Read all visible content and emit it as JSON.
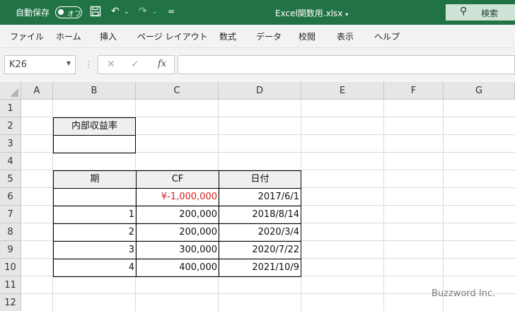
{
  "titlebar": {
    "autosave_label": "自動保存",
    "autosave_state": "オフ",
    "filename": "Excel関数用.xlsx",
    "search_label": "検索"
  },
  "menu": [
    "ファイル",
    "ホーム",
    "挿入",
    "ページ レイアウト",
    "数式",
    "データ",
    "校閲",
    "表示",
    "ヘルプ"
  ],
  "formula_bar": {
    "name_box": "K26",
    "fx_label": "fx",
    "formula": ""
  },
  "columns": [
    "A",
    "B",
    "C",
    "D",
    "E",
    "F",
    "G"
  ],
  "rows": [
    "1",
    "2",
    "3",
    "4",
    "5",
    "6",
    "7",
    "8",
    "9",
    "10",
    "11",
    "12"
  ],
  "sheet": {
    "irr_header": "内部収益率",
    "irr_value": "",
    "table_headers": [
      "期",
      "CF",
      "日付"
    ],
    "table_rows": [
      {
        "period": "",
        "cf": "¥-1,000,000",
        "date": "2017/6/1"
      },
      {
        "period": "1",
        "cf": "200,000",
        "date": "2018/8/14"
      },
      {
        "period": "2",
        "cf": "200,000",
        "date": "2020/3/4"
      },
      {
        "period": "3",
        "cf": "300,000",
        "date": "2020/7/22"
      },
      {
        "period": "4",
        "cf": "400,000",
        "date": "2021/10/9"
      }
    ]
  },
  "watermark": "Buzzword Inc.",
  "colors": {
    "title_bar": "#217346",
    "negative": "#d61f1f"
  }
}
